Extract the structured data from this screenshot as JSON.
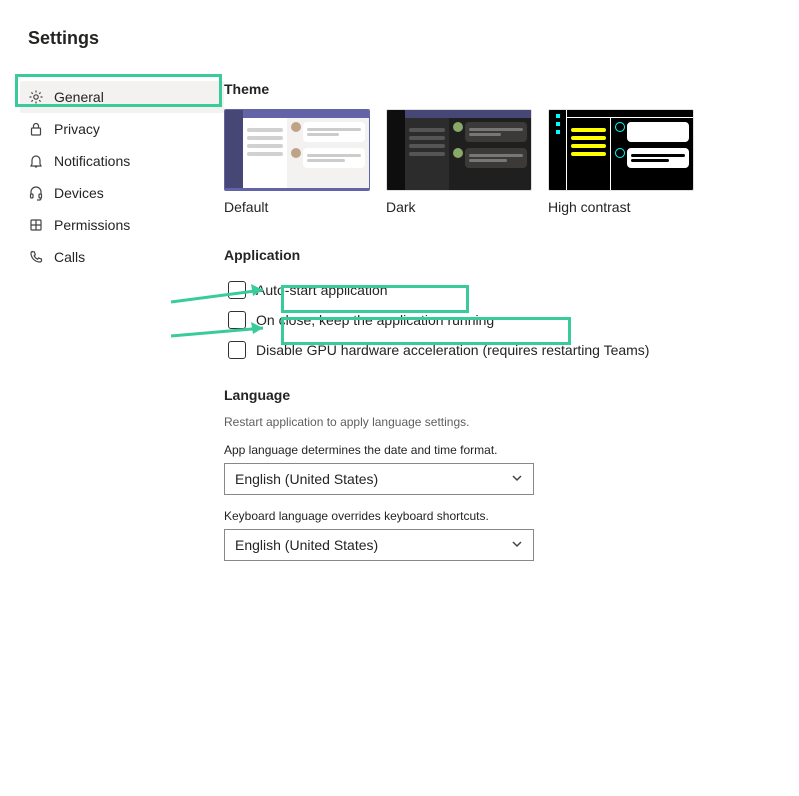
{
  "page": {
    "title": "Settings"
  },
  "sidebar": {
    "items": [
      {
        "label": "General",
        "icon": "gear-icon",
        "active": true
      },
      {
        "label": "Privacy",
        "icon": "lock-icon",
        "active": false
      },
      {
        "label": "Notifications",
        "icon": "bell-icon",
        "active": false
      },
      {
        "label": "Devices",
        "icon": "headset-icon",
        "active": false
      },
      {
        "label": "Permissions",
        "icon": "key-icon",
        "active": false
      },
      {
        "label": "Calls",
        "icon": "phone-icon",
        "active": false
      }
    ]
  },
  "theme": {
    "heading": "Theme",
    "options": [
      {
        "label": "Default",
        "selected": true
      },
      {
        "label": "Dark",
        "selected": false
      },
      {
        "label": "High contrast",
        "selected": false
      }
    ]
  },
  "application": {
    "heading": "Application",
    "options": [
      {
        "label": "Auto-start application",
        "checked": false
      },
      {
        "label": "On close, keep the application running",
        "checked": false
      },
      {
        "label": "Disable GPU hardware acceleration (requires restarting Teams)",
        "checked": false
      }
    ]
  },
  "language": {
    "heading": "Language",
    "description": "Restart application to apply language settings.",
    "app_label": "App language determines the date and time format.",
    "app_value": "English (United States)",
    "keyboard_label": "Keyboard language overrides keyboard shortcuts.",
    "keyboard_value": "English (United States)"
  },
  "annotations": {
    "highlight_color": "#39cb9c"
  }
}
